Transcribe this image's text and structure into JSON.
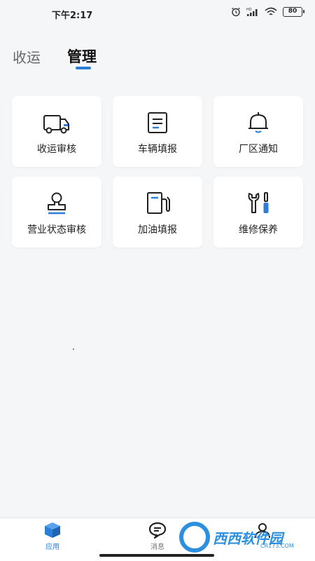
{
  "status_bar": {
    "time": "下午2:17",
    "battery": "80",
    "network": "HD"
  },
  "tabs": [
    {
      "label": "收运",
      "active": false
    },
    {
      "label": "管理",
      "active": true
    }
  ],
  "grid": [
    {
      "label": "收运审核",
      "icon": "truck-icon"
    },
    {
      "label": "车辆填报",
      "icon": "form-icon"
    },
    {
      "label": "厂区通知",
      "icon": "bell-icon"
    },
    {
      "label": "营业状态审核",
      "icon": "stamp-icon"
    },
    {
      "label": "加油填报",
      "icon": "fuel-icon"
    },
    {
      "label": "维修保养",
      "icon": "wrench-screwdriver-icon"
    }
  ],
  "bottom_nav": [
    {
      "label": "应用",
      "icon": "cube-icon",
      "active": true
    },
    {
      "label": "消息",
      "icon": "chat-icon",
      "active": false
    },
    {
      "label": "",
      "icon": "user-icon",
      "active": false
    }
  ],
  "watermark": {
    "text": "西西软件园",
    "url": "CR173.COM"
  },
  "colors": {
    "accent": "#2c7fd8",
    "background": "#f5f6f8",
    "card": "#ffffff"
  }
}
